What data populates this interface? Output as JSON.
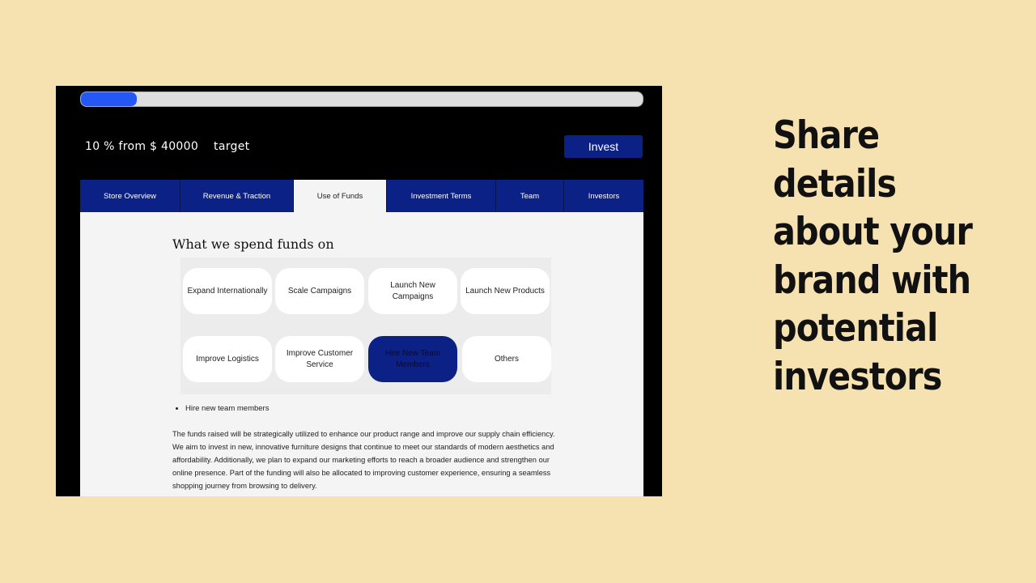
{
  "progress": {
    "percent": 10,
    "label": "10 % from $ 40000    target",
    "color": "#2557f5"
  },
  "invest_label": "Invest",
  "tabs": [
    {
      "label": "Store Overview"
    },
    {
      "label": "Revenue & Traction"
    },
    {
      "label": "Use of Funds",
      "active": true
    },
    {
      "label": "Investment Terms"
    },
    {
      "label": "Team"
    },
    {
      "label": "Investors"
    }
  ],
  "section": {
    "title": "What we spend funds on",
    "options": [
      {
        "label": "Expand Internationally"
      },
      {
        "label": "Scale Campaigns"
      },
      {
        "label": "Launch New Campaigns"
      },
      {
        "label": "Launch New Products"
      },
      {
        "label": "Improve Logistics"
      },
      {
        "label": "Improve Customer Service"
      },
      {
        "label": "Hire New Team Members",
        "selected": true
      },
      {
        "label": "Others"
      }
    ],
    "selected_list": [
      "Hire new team members"
    ],
    "description": "The funds raised will be strategically utilized to enhance our product range and improve our supply chain efficiency. We aim to invest in new, innovative furniture designs that continue to meet our standards of modern aesthetics and affordability. Additionally, we plan to expand our marketing efforts to reach a broader audience and strengthen our online presence. Part of the funding will also be allocated to improving customer experience, ensuring a seamless shopping journey from browsing to delivery."
  },
  "slogan": "Share details about your brand with potential investors",
  "colors": {
    "brand": "#0c2186",
    "background": "#f6e1b1"
  }
}
